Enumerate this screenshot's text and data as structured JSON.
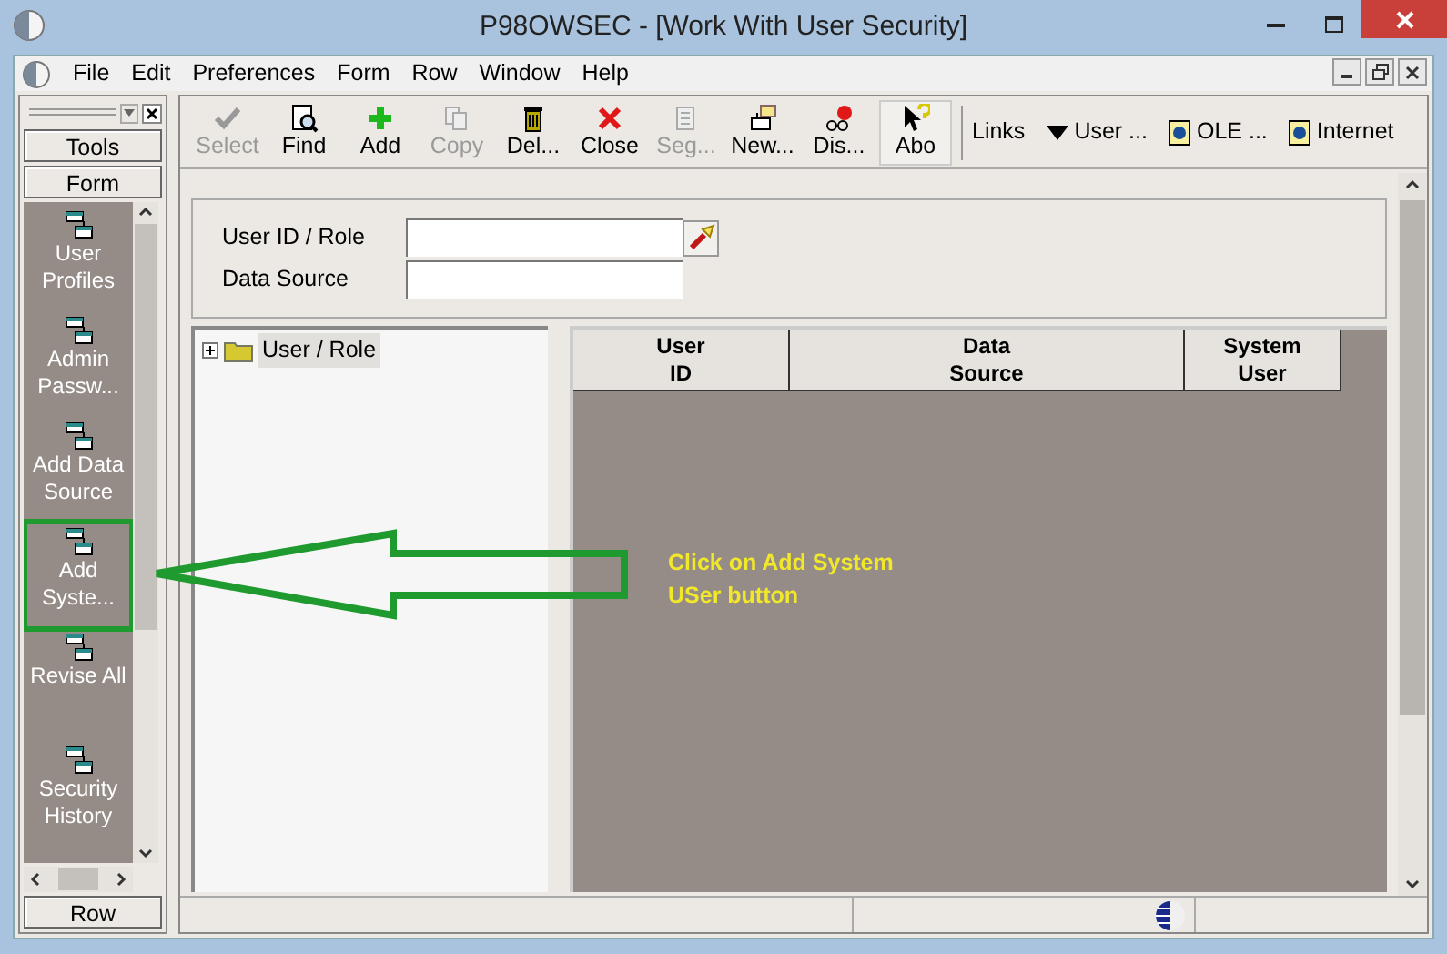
{
  "window": {
    "title": "P98OWSEC - [Work With User Security]"
  },
  "menu": [
    "File",
    "Edit",
    "Preferences",
    "Form",
    "Row",
    "Window",
    "Help"
  ],
  "sidebar": {
    "top_buttons": [
      "Tools",
      "Form"
    ],
    "items": [
      {
        "label": "User Profiles"
      },
      {
        "label": "Admin Passw..."
      },
      {
        "label": "Add Data Source"
      },
      {
        "label": "Add Syste...",
        "highlighted": true
      },
      {
        "label": "Revise All"
      },
      {
        "label": "Security History"
      }
    ],
    "bottom_button": "Row"
  },
  "toolbar": {
    "buttons": [
      {
        "kind": "select",
        "label": "Select",
        "disabled": true
      },
      {
        "kind": "find",
        "label": "Find",
        "disabled": false
      },
      {
        "kind": "add",
        "label": "Add",
        "disabled": false
      },
      {
        "kind": "copy",
        "label": "Copy",
        "disabled": true
      },
      {
        "kind": "delete",
        "label": "Del...",
        "disabled": false
      },
      {
        "kind": "close",
        "label": "Close",
        "disabled": false
      },
      {
        "kind": "seg",
        "label": "Seg...",
        "disabled": true
      },
      {
        "kind": "new",
        "label": "New...",
        "disabled": false
      },
      {
        "kind": "display",
        "label": "Dis...",
        "disabled": false
      },
      {
        "kind": "about",
        "label": "Abo",
        "disabled": false
      }
    ],
    "links_label": "Links",
    "links": [
      {
        "kind": "dropdown",
        "label": "User ..."
      },
      {
        "kind": "doc",
        "label": "OLE ..."
      },
      {
        "kind": "doc",
        "label": "Internet"
      }
    ]
  },
  "query": {
    "fields": [
      {
        "label": "User ID / Role",
        "kind": "search"
      },
      {
        "label": "Data Source",
        "kind": "plain"
      }
    ]
  },
  "tree": [
    {
      "label": "User / Role",
      "expanded": false
    }
  ],
  "grid": {
    "columns": [
      "User\nID",
      "Data\nSource",
      "System\nUser"
    ]
  },
  "annotation": {
    "lines": [
      "Click on Add System",
      "USer button"
    ]
  }
}
